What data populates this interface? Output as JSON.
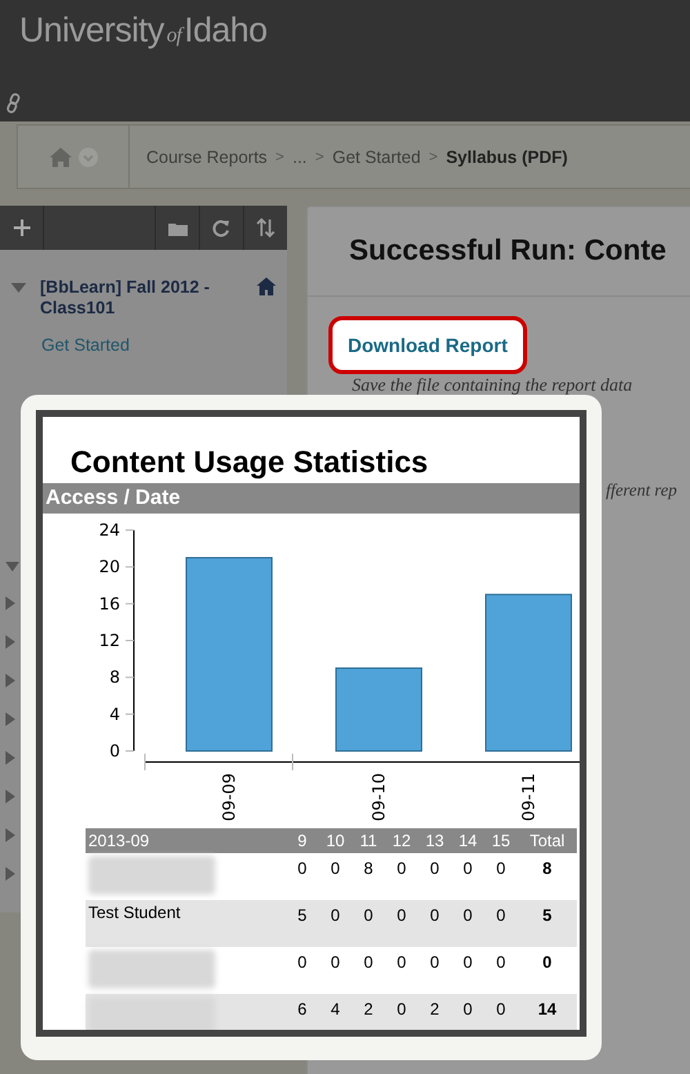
{
  "header": {
    "logo": {
      "main": "University",
      "small": "of",
      "end": "Idaho"
    }
  },
  "breadcrumbs": [
    {
      "label": "Course Reports",
      "current": false
    },
    {
      "separator": ">",
      "label": "...",
      "current": false
    },
    {
      "separator": ">",
      "label": "Get Started",
      "current": false
    },
    {
      "separator": ">",
      "label": "Syllabus (PDF)",
      "current": true
    }
  ],
  "course_menu": {
    "course_title": "[BbLearn] Fall 2012 - Class101",
    "items": [
      {
        "label": "Get Started"
      }
    ]
  },
  "content": {
    "title": "Successful Run: Conte",
    "download_button": "Download Report",
    "note": "Save the file containing the report data",
    "note_cut": "fferent rep"
  },
  "report_popup": {
    "title": "Content Usage Statistics",
    "section": "Access / Date",
    "chart_data": {
      "type": "bar",
      "categories": [
        "09-09",
        "09-10",
        "09-11"
      ],
      "values": [
        21,
        9,
        17
      ],
      "ylim": [
        0,
        24
      ],
      "yticks": [
        0,
        4,
        8,
        12,
        16,
        20,
        24
      ]
    },
    "table": {
      "columns": [
        "2013-09",
        "9",
        "10",
        "11",
        "12",
        "13",
        "14",
        "15",
        "Total"
      ],
      "rows": [
        {
          "redacted": true,
          "cells": [
            "",
            "0",
            "0",
            "8",
            "0",
            "0",
            "0",
            "0",
            "8"
          ]
        },
        {
          "redacted": false,
          "cells": [
            "Test Student",
            "5",
            "0",
            "0",
            "0",
            "0",
            "0",
            "0",
            "5"
          ]
        },
        {
          "redacted": true,
          "cells": [
            "",
            "0",
            "0",
            "0",
            "0",
            "0",
            "0",
            "0",
            "0"
          ]
        },
        {
          "redacted": true,
          "cells": [
            "",
            "6",
            "4",
            "2",
            "0",
            "2",
            "0",
            "0",
            "14"
          ]
        }
      ]
    }
  }
}
